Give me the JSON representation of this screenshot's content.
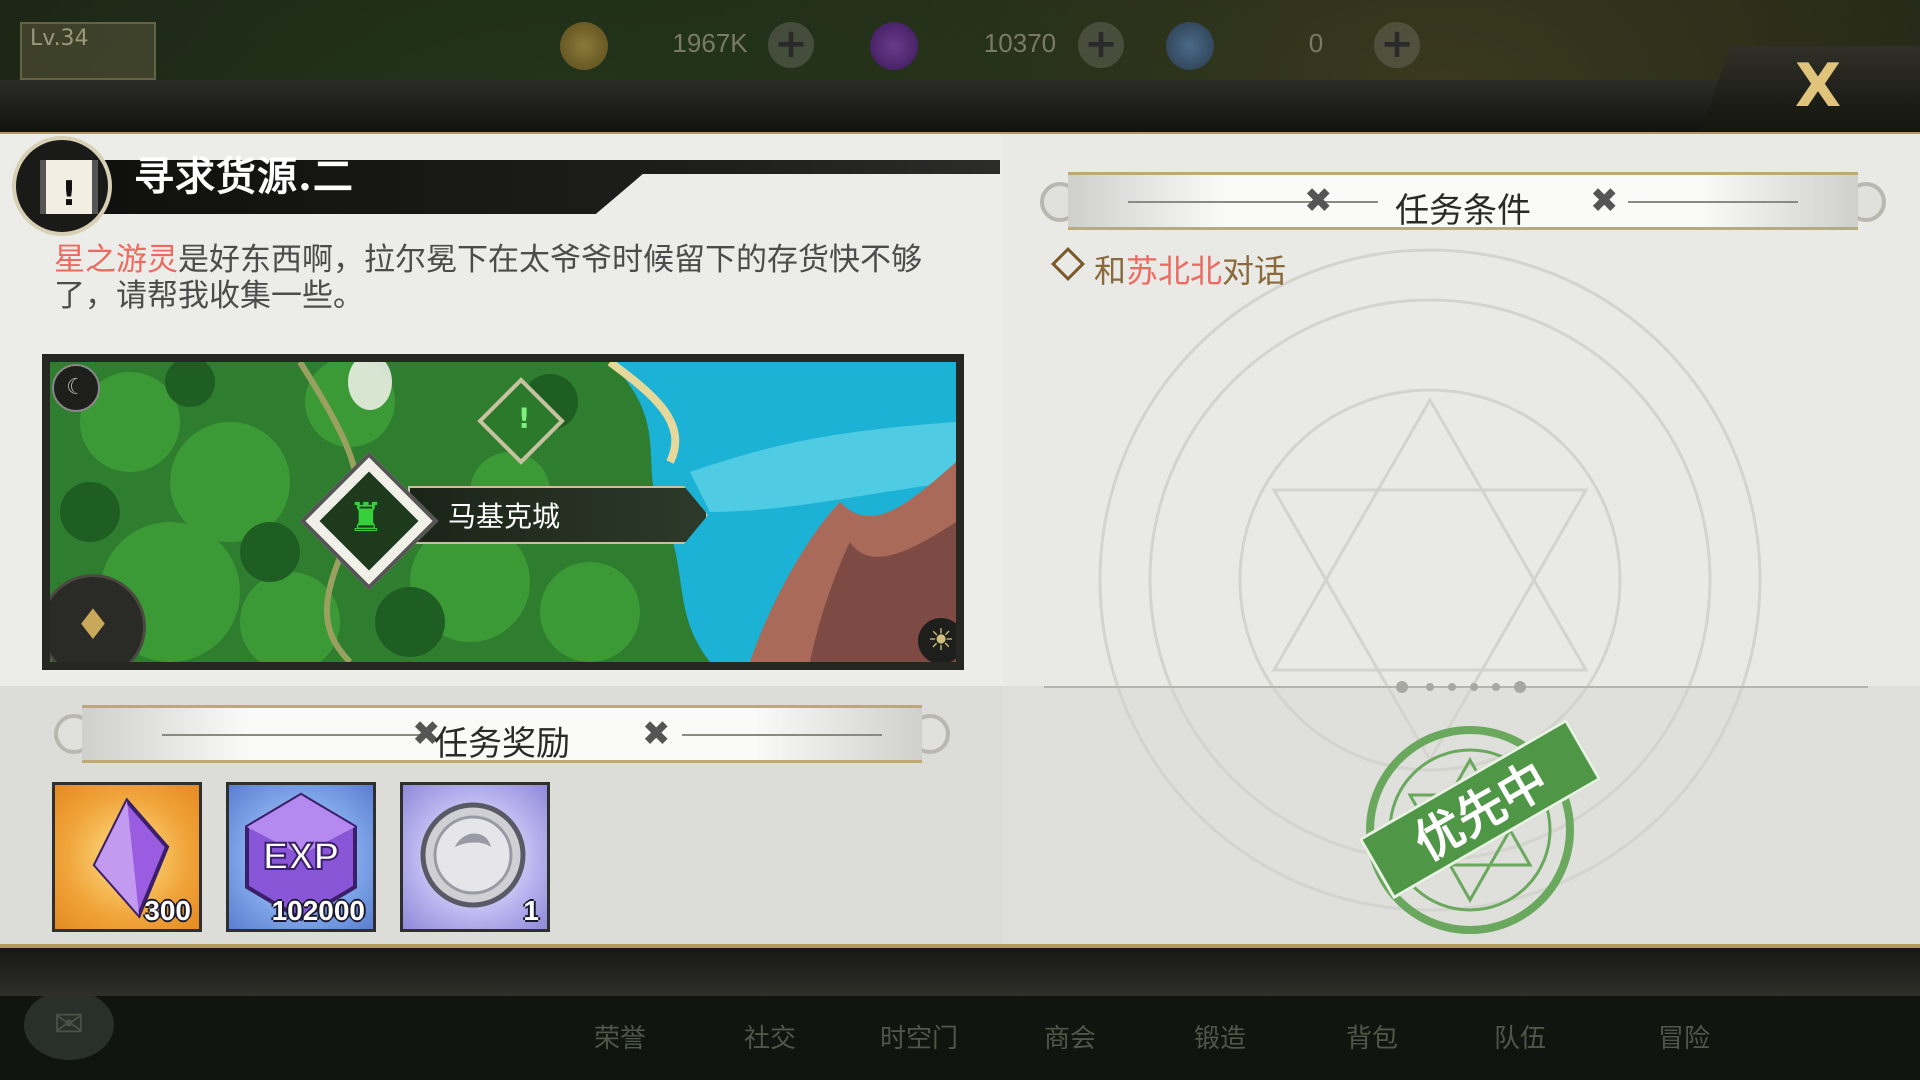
{
  "hud": {
    "level": "Lv.34",
    "gold": "1967K",
    "gems": "10370",
    "tokens": "0",
    "plus": "+"
  },
  "close_label": "X",
  "quest": {
    "title": "寻求货源.二",
    "desc_highlight": "星之游灵",
    "desc_rest": "是好东西啊，拉尔冕下在太爷爷时候留下的存货快不够了，请帮我收集一些。",
    "map_location": "马基克城"
  },
  "rewards": {
    "header": "任务奖励",
    "items": [
      {
        "icon": "purple-crystal-icon",
        "qty": "300"
      },
      {
        "icon": "exp-crystal-icon",
        "qty": "102000"
      },
      {
        "icon": "silver-coin-icon",
        "qty": "1"
      }
    ]
  },
  "conditions": {
    "header": "任务条件",
    "item_prefix": "和",
    "item_name": "苏北北",
    "item_suffix": "对话"
  },
  "status_stamp": "优先中",
  "bottom_nav": [
    "荣誉",
    "社交",
    "时空门",
    "商会",
    "锻造",
    "背包",
    "队伍",
    "冒险"
  ],
  "colors": {
    "highlight": "#ee6a60",
    "gold_trim": "#b49a5a",
    "stamp_green": "#4f9646"
  }
}
